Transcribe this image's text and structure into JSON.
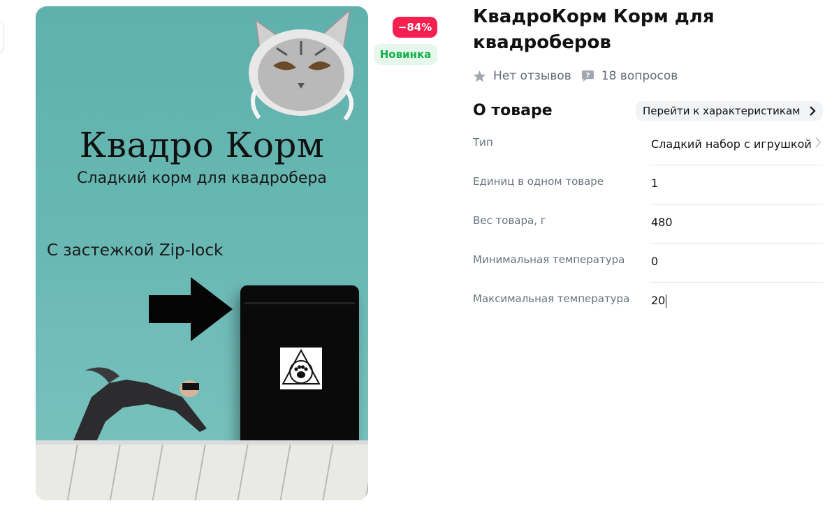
{
  "product_image": {
    "headline": "Квадро Корм",
    "subheadline": "Сладкий корм для квадробера",
    "zip_note": "С застежкой Zip-lock"
  },
  "badges": {
    "discount": "−84%",
    "new": "Новинка"
  },
  "product": {
    "title": "КвадроКорм Корм для квадроберов",
    "reviews": "Нет отзывов",
    "questions": "18 вопросов"
  },
  "about": {
    "title": "О товаре",
    "goto_label": "Перейти к характеристикам",
    "specs": [
      {
        "key": "Тип",
        "value": "Сладкий набор с игрушкой"
      },
      {
        "key": "Единиц в одном товаре",
        "value": "1"
      },
      {
        "key": "Вес товара, г",
        "value": "480"
      },
      {
        "key": "Минимальная температура",
        "value": "0"
      },
      {
        "key": "Максимальная температура",
        "value": "20"
      }
    ]
  },
  "colors": {
    "discount_badge": "#f5204f",
    "new_badge_text": "#10b04a",
    "photo_background": "#68b7b3"
  }
}
